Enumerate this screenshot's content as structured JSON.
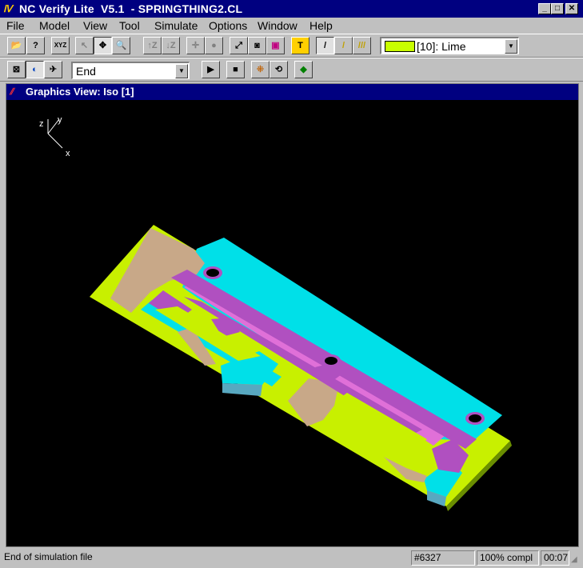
{
  "window": {
    "title": "NC Verify Lite  V5.1  - SPRINGTHING2.CL",
    "minimize_glyph": "_",
    "maximize_glyph": "□",
    "close_glyph": "✕"
  },
  "menu": [
    "File",
    "Model",
    "View",
    "Tool",
    "Simulate",
    "Options",
    "Window",
    "Help"
  ],
  "toolbar1": {
    "buttons": [
      {
        "name": "open-file-icon",
        "glyph": "📂"
      },
      {
        "name": "help-pointer-icon",
        "glyph": "?"
      },
      {
        "name": "xyz-axes-icon",
        "glyph": "XYZ"
      },
      {
        "name": "select-arrow-icon",
        "glyph": "↖"
      },
      {
        "name": "pan-icon",
        "glyph": "✥"
      },
      {
        "name": "zoom-magnifier-icon",
        "glyph": "🔍"
      },
      {
        "name": "rotate-z-up-icon",
        "glyph": "↑Z"
      },
      {
        "name": "rotate-z-down-icon",
        "glyph": "↓Z"
      },
      {
        "name": "center-target-icon",
        "glyph": "✛"
      },
      {
        "name": "shaded-sphere-icon",
        "glyph": "●"
      },
      {
        "name": "axis-view-icon",
        "glyph": "⤢"
      },
      {
        "name": "camera-snapshot-icon",
        "glyph": "◙"
      },
      {
        "name": "print-icon",
        "glyph": "▣"
      },
      {
        "name": "tool-holder-icon",
        "glyph": "T"
      },
      {
        "name": "tool-single-icon",
        "glyph": "/"
      },
      {
        "name": "tool-yellow-icon",
        "glyph": "/"
      },
      {
        "name": "tool-multiple-icon",
        "glyph": "///"
      }
    ],
    "color_combo_value": "[10]: Lime",
    "color_swatch": "#c8ff00"
  },
  "toolbar2": {
    "buttons": [
      {
        "name": "stock-model-icon",
        "glyph": "⊠"
      },
      {
        "name": "globe-view-icon",
        "glyph": "◐"
      },
      {
        "name": "fly-mode-icon",
        "glyph": "✈"
      }
    ],
    "playback_combo_value": "End",
    "controls": [
      {
        "name": "play-icon",
        "glyph": "▶"
      },
      {
        "name": "stop-icon",
        "glyph": "■"
      },
      {
        "name": "step-forward-icon",
        "glyph": "⁜"
      },
      {
        "name": "rewind-icon",
        "glyph": "⟲"
      },
      {
        "name": "part-compare-icon",
        "glyph": "◆"
      }
    ]
  },
  "graphics_view": {
    "title": "Graphics View: Iso [1]",
    "axes": {
      "z": "z",
      "y": "y",
      "x": "x"
    },
    "colors": {
      "base": "#c8f000",
      "raised": "#00e0e8",
      "wall": "#b050c0",
      "floor": "#e070d8",
      "rough": "#c8a888",
      "side": "#58a8c0"
    }
  },
  "status": {
    "message": "End of simulation file",
    "record": "#6327",
    "progress": "100% compl",
    "time": "00:07"
  }
}
